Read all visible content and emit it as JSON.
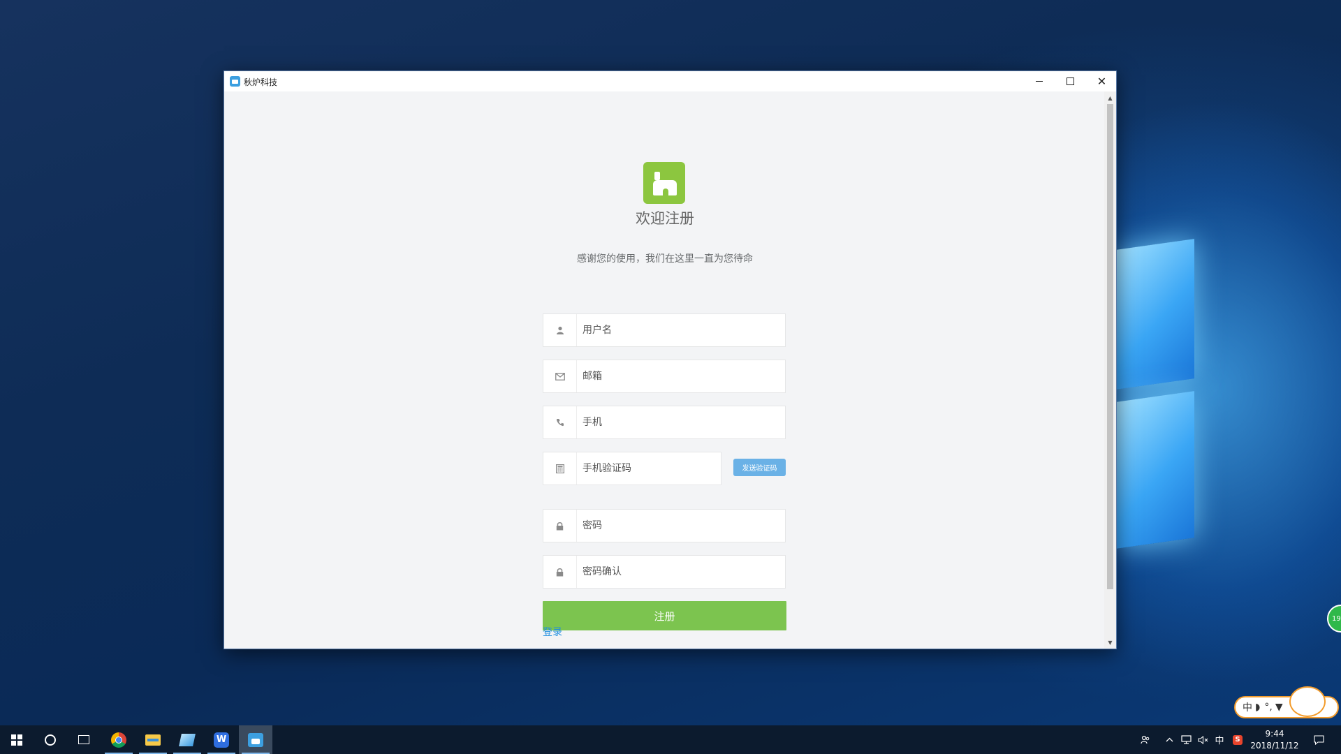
{
  "window": {
    "title": "秋炉科技",
    "controls": {
      "minimize": "minimize",
      "maximize": "maximize",
      "close": "✕"
    }
  },
  "register": {
    "heading": "欢迎注册",
    "subtitle": "感谢您的使用，我们在这里一直为您待命",
    "fields": {
      "username": "用户名",
      "email": "邮箱",
      "phone": "手机",
      "sms_code": "手机验证码",
      "password": "密码",
      "password_confirm": "密码确认"
    },
    "send_code_label": "发送验证码",
    "submit_label": "注册",
    "login_link": "登录"
  },
  "taskbar": {
    "ime_indicator": "中",
    "time": "9:44",
    "date": "2018/11/12",
    "ime_float_label": "中",
    "badge_text": "19"
  },
  "icons": {
    "user": "user-icon",
    "email": "envelope-icon",
    "phone": "phone-icon",
    "calculator": "calculator-icon",
    "lock": "lock-icon"
  },
  "colors": {
    "primary_green": "#7cc44f",
    "logo_green": "#8cc63f",
    "send_code_blue": "#6ab1e6",
    "link_blue": "#1f8ee0"
  }
}
